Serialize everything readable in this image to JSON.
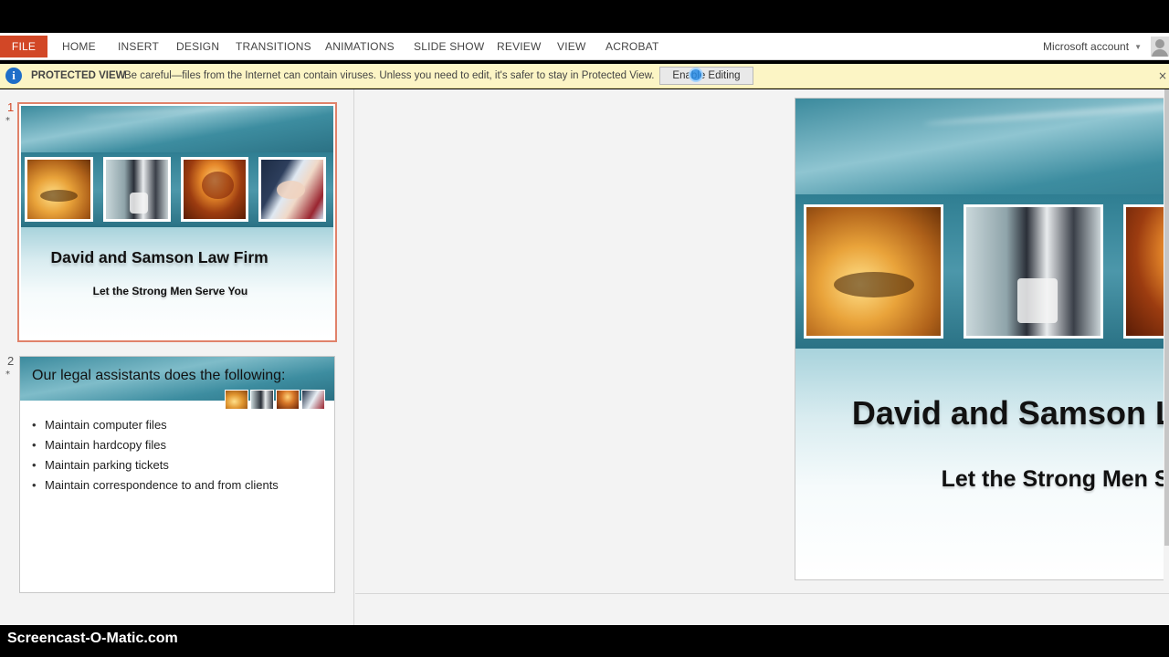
{
  "ribbon": {
    "file_tab": "FILE",
    "tabs": [
      "HOME",
      "INSERT",
      "DESIGN",
      "TRANSITIONS",
      "ANIMATIONS",
      "SLIDE SHOW",
      "REVIEW",
      "VIEW",
      "ACROBAT"
    ],
    "account": "Microsoft account"
  },
  "protected_view": {
    "label": "PROTECTED VIEW",
    "message": "Be careful—files from the Internet can contain viruses. Unless you need to edit, it's safer to stay in Protected View.",
    "button": "Enable Editing",
    "close": "×",
    "icon": "i"
  },
  "thumbnails": [
    {
      "number": "1",
      "marker": "*",
      "title": "David and Samson Law Firm",
      "subtitle": "Let the Strong Men Serve You"
    },
    {
      "number": "2",
      "marker": "*",
      "title": "Our legal assistants does the following:",
      "bullets": [
        "Maintain computer files",
        "Maintain hardcopy files",
        "Maintain parking tickets",
        "Maintain correspondence to and from clients"
      ]
    }
  ],
  "current_slide": {
    "title": "David and Samson Law Firm",
    "subtitle": "Let the Strong Men Serve You"
  },
  "watermark": "Screencast-O-Matic.com",
  "colors": {
    "file_tab": "#d24726",
    "protected_bar": "#fcf5c5",
    "selected_thumb_border": "#e0826a",
    "theme_teal": "#3d8da0"
  }
}
